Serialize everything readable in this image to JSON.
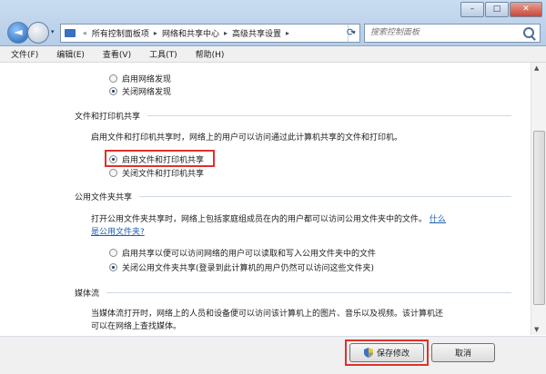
{
  "window": {
    "minimize_glyph": "–",
    "maximize_glyph": "□",
    "close_glyph": "✕"
  },
  "nav": {
    "back_glyph": "◄",
    "history_glyph": "▾",
    "overflow": "«",
    "breadcrumbs": [
      "所有控制面板项",
      "网络和共享中心",
      "高级共享设置"
    ],
    "sep": "▸",
    "dropdown_glyph": "▾",
    "refresh_glyph": "⟳",
    "search_placeholder": "搜索控制面板"
  },
  "menu": [
    "文件(F)",
    "编辑(E)",
    "查看(V)",
    "工具(T)",
    "帮助(H)"
  ],
  "network_discovery": {
    "options": [
      "启用网络发现",
      "关闭网络发现"
    ],
    "selected": 1
  },
  "file_printer": {
    "heading": "文件和打印机共享",
    "description": "启用文件和打印机共享时，网络上的用户可以访问通过此计算机共享的文件和打印机。",
    "options": [
      "启用文件和打印机共享",
      "关闭文件和打印机共享"
    ],
    "selected": 0
  },
  "public_folder": {
    "heading": "公用文件夹共享",
    "description": "打开公用文件夹共享时，网络上包括家庭组成员在内的用户都可以访问公用文件夹中的文件。",
    "link_part1": "什么",
    "link_part2": "是公用文件夹?",
    "options": [
      "启用共享以便可以访问网络的用户可以读取和写入公用文件夹中的文件",
      "关闭公用文件夹共享(登录到此计算机的用户仍然可以访问这些文件夹)"
    ],
    "selected": 1
  },
  "media": {
    "heading": "媒体流",
    "description_line1": "当媒体流打开时，网络上的人员和设备便可以访问该计算机上的图片、音乐以及视频。该计算机还",
    "description_line2": "可以在网络上查找媒体。"
  },
  "scroll": {
    "up": "▲",
    "down": "▼"
  },
  "buttons": {
    "save": "保存修改",
    "cancel": "取消"
  },
  "colors": {
    "highlight": "#e0302b",
    "link": "#1a5fb4"
  }
}
